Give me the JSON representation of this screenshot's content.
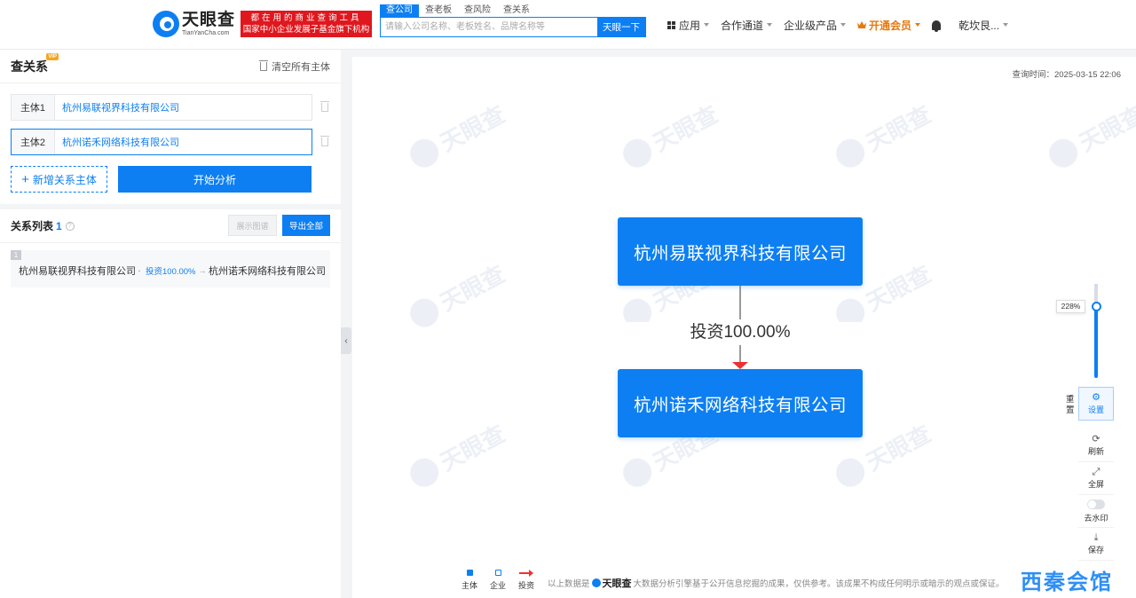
{
  "header": {
    "logo_cn": "天眼查",
    "logo_en": "TianYanCha.com",
    "slogan_line1": "都在用的商业查询工具",
    "slogan_line2": "国家中小企业发展子基金旗下机构",
    "search_tabs": [
      "查公司",
      "查老板",
      "查风险",
      "查关系"
    ],
    "search_placeholder": "请输入公司名称、老板姓名、品牌名称等",
    "search_button": "天眼一下",
    "nav": {
      "apps": "应用",
      "partners": "合作通道",
      "enterprise": "企业级产品",
      "vip": "开通会员",
      "user": "乾坎艮..."
    }
  },
  "left_panel": {
    "title": "查关系",
    "vip_badge": "VIP",
    "clear_all": "清空所有主体",
    "entities": [
      {
        "label": "主体1",
        "value": "杭州易联视界科技有限公司"
      },
      {
        "label": "主体2",
        "value": "杭州诺禾网络科技有限公司"
      }
    ],
    "add_button": "新增关系主体",
    "start_button": "开始分析",
    "list_title": "关系列表",
    "list_count": "1",
    "show_graph": "展示图谱",
    "export_all": "导出全部",
    "relations": [
      {
        "index": "1",
        "from": "杭州易联视界科技有限公司",
        "edge": "投资100.00%",
        "to": "杭州诺禾网络科技有限公司"
      }
    ]
  },
  "canvas": {
    "query_time": "查询时间：2025-03-15 22:06",
    "watermark": "天眼查",
    "node_top": "杭州易联视界科技有限公司",
    "node_bottom": "杭州诺禾网络科技有限公司",
    "edge_label": "投资100.00%",
    "zoom": "228%",
    "reset": "重置",
    "tools": [
      {
        "icon": "gear-icon",
        "label": "设置"
      },
      {
        "icon": "refresh-icon",
        "label": "刷新"
      },
      {
        "icon": "fullscreen-icon",
        "label": "全屏"
      },
      {
        "icon": "toggle-icon",
        "label": "去水印"
      },
      {
        "icon": "download-icon",
        "label": "保存"
      }
    ],
    "legend": [
      "主体",
      "企业",
      "投资"
    ],
    "disclaimer_prefix": "以上数据是",
    "disclaimer_logo": "天眼查",
    "disclaimer_suffix": "大数据分析引擎基于公开信息挖掘的成果，仅供参考。该成果不构成任何明示或暗示的观点或保证。",
    "corner_mark": "西秦会馆"
  },
  "colors": {
    "primary": "#0d7ff2",
    "slogan_red": "#e0171e",
    "vip_orange": "#e47a11",
    "arrow_red": "#f03030"
  }
}
